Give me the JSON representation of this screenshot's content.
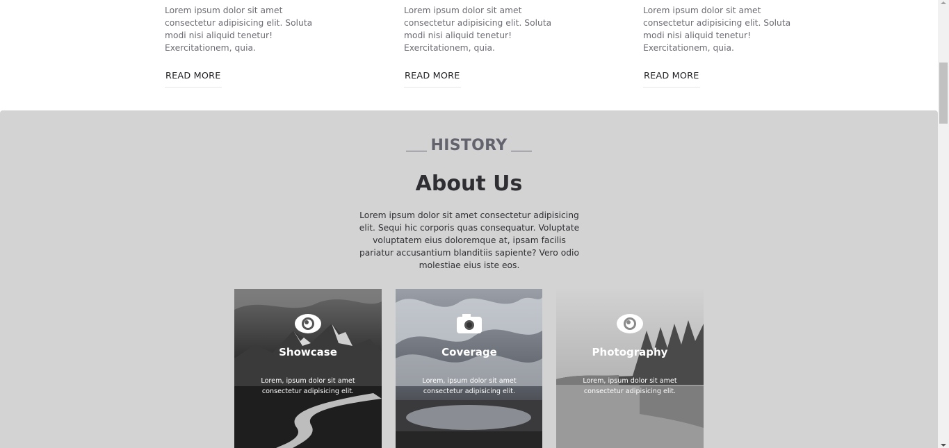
{
  "blog": {
    "items": [
      {
        "text": "Lorem ipsum dolor sit amet consectetur adipisicing elit. Soluta modi nisi aliquid tenetur! Exercitationem, quia.",
        "link": "READ MORE"
      },
      {
        "text": "Lorem ipsum dolor sit amet consectetur adipisicing elit. Soluta modi nisi aliquid tenetur! Exercitationem, quia.",
        "link": "READ MORE"
      },
      {
        "text": "Lorem ipsum dolor sit amet consectetur adipisicing elit. Soluta modi nisi aliquid tenetur! Exercitationem, quia.",
        "link": "READ MORE"
      }
    ]
  },
  "history": {
    "kicker": "HISTORY",
    "title": "About Us",
    "lead": "Lorem ipsum dolor sit amet consectetur adipisicing elit. Sequi hic corporis quas consequatur. Voluptate voluptatem eius doloremque at, ipsam facilis pariatur accusantium blanditiis sapiente? Vero odio molestiae eius iste eos."
  },
  "cards": [
    {
      "title": "Showcase",
      "text": "Lorem, ipsum dolor sit amet consectetur adipisicing elit.",
      "icon": "eye-icon"
    },
    {
      "title": "Coverage",
      "text": "Lorem, ipsum dolor sit amet consectetur adipisicing elit.",
      "icon": "camera-icon"
    },
    {
      "title": "Photography",
      "text": "Lorem, ipsum dolor sit amet consectetur adipisicing elit.",
      "icon": "eye-icon"
    }
  ],
  "colors": {
    "section_bg": "#d3d3d4",
    "kicker": "#62636d",
    "title": "#2f2f33"
  }
}
